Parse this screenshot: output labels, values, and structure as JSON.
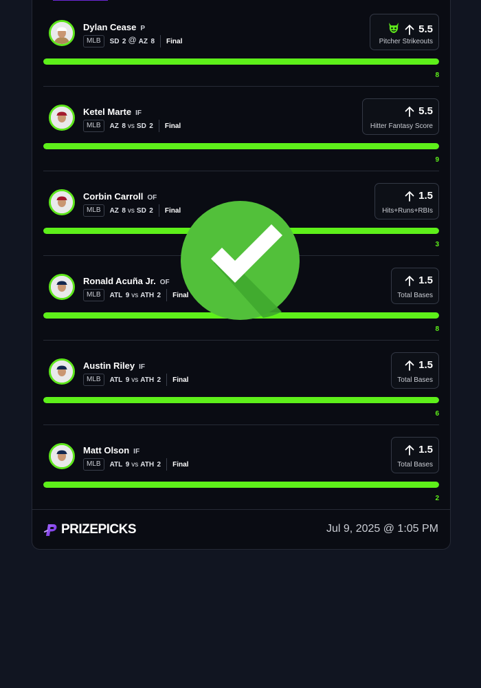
{
  "picks": [
    {
      "name": "Dylan Cease",
      "position": "P",
      "league": "MLB",
      "team1": "SD",
      "score1": "2",
      "sep": "@",
      "team2": "AZ",
      "score2": "8",
      "status": "Final",
      "line": "5.5",
      "stat": "Pitcher Strikeouts",
      "actual": "8",
      "badge": "demon-icon",
      "progress": 1.0,
      "cap": "#ffffff",
      "jersey": "#b08a5a"
    },
    {
      "name": "Ketel Marte",
      "position": "IF",
      "league": "MLB",
      "team1": "AZ",
      "score1": "8",
      "sep": "vs",
      "team2": "SD",
      "score2": "2",
      "status": "Final",
      "line": "5.5",
      "stat": "Hitter Fantasy Score",
      "actual": "9",
      "badge": "",
      "progress": 1.0,
      "cap": "#a3192e",
      "jersey": "#e9e9ea"
    },
    {
      "name": "Corbin Carroll",
      "position": "OF",
      "league": "MLB",
      "team1": "AZ",
      "score1": "8",
      "sep": "vs",
      "team2": "SD",
      "score2": "2",
      "status": "Final",
      "line": "1.5",
      "stat": "Hits+Runs+RBIs",
      "actual": "3",
      "badge": "",
      "progress": 1.0,
      "cap": "#a3192e",
      "jersey": "#e9e9ea"
    },
    {
      "name": "Ronald Acuña Jr.",
      "position": "OF",
      "league": "MLB",
      "team1": "ATL",
      "score1": "9",
      "sep": "vs",
      "team2": "ATH",
      "score2": "2",
      "status": "Final",
      "line": "1.5",
      "stat": "Total Bases",
      "actual": "8",
      "badge": "",
      "progress": 1.0,
      "cap": "#13274f",
      "jersey": "#e9e9ea"
    },
    {
      "name": "Austin Riley",
      "position": "IF",
      "league": "MLB",
      "team1": "ATL",
      "score1": "9",
      "sep": "vs",
      "team2": "ATH",
      "score2": "2",
      "status": "Final",
      "line": "1.5",
      "stat": "Total Bases",
      "actual": "6",
      "badge": "",
      "progress": 1.0,
      "cap": "#13274f",
      "jersey": "#e9e9ea"
    },
    {
      "name": "Matt Olson",
      "position": "IF",
      "league": "MLB",
      "team1": "ATL",
      "score1": "9",
      "sep": "vs",
      "team2": "ATH",
      "score2": "2",
      "status": "Final",
      "line": "1.5",
      "stat": "Total Bases",
      "actual": "2",
      "badge": "",
      "progress": 1.0,
      "cap": "#13274f",
      "jersey": "#e9e9ea"
    }
  ],
  "footer": {
    "brand": "PRIZEPICKS",
    "date": "Jul 9, 2025 @ 1:05 PM"
  },
  "colors": {
    "accent": "#5ef01a",
    "check": "#4cbb3a"
  },
  "overlay": {
    "icon": "checkmark-icon"
  }
}
